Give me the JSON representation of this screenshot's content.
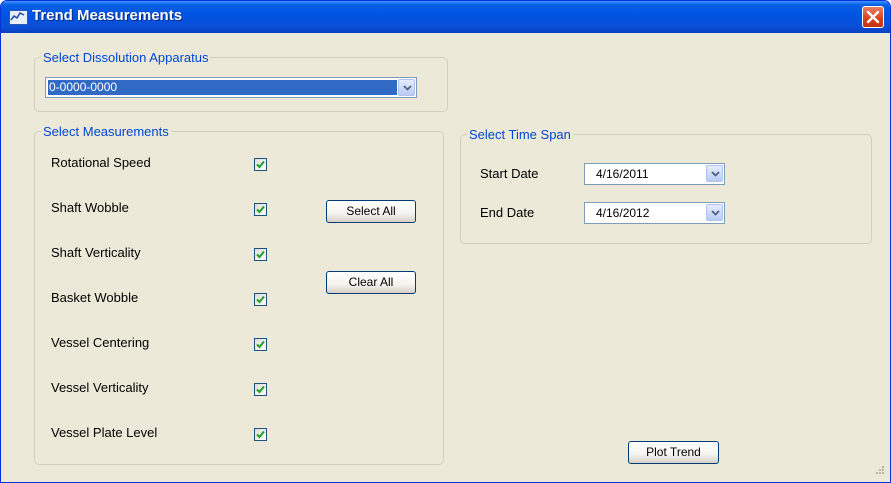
{
  "window": {
    "title": "Trend Measurements"
  },
  "apparatus": {
    "legend": "Select Dissolution Apparatus",
    "selected": "0-0000-0000"
  },
  "measurements": {
    "legend": "Select Measurements",
    "items": [
      {
        "label": "Rotational Speed",
        "checked": true
      },
      {
        "label": "Shaft Wobble",
        "checked": true
      },
      {
        "label": "Shaft Verticality",
        "checked": true
      },
      {
        "label": "Basket Wobble",
        "checked": true
      },
      {
        "label": "Vessel Centering",
        "checked": true
      },
      {
        "label": "Vessel Verticality",
        "checked": true
      },
      {
        "label": "Vessel Plate Level",
        "checked": true
      }
    ],
    "select_all_label": "Select All",
    "clear_all_label": "Clear All"
  },
  "timespan": {
    "legend": "Select Time Span",
    "start_label": "Start Date",
    "start_value": "4/16/2011",
    "end_label": "End Date",
    "end_value": "4/16/2012"
  },
  "plot_trend_label": "Plot Trend",
  "colors": {
    "title_bar": "#0055e5",
    "group_text": "#0046d5",
    "selection": "#316ac5",
    "client_bg": "#ece9d8",
    "check": "#21a121"
  }
}
